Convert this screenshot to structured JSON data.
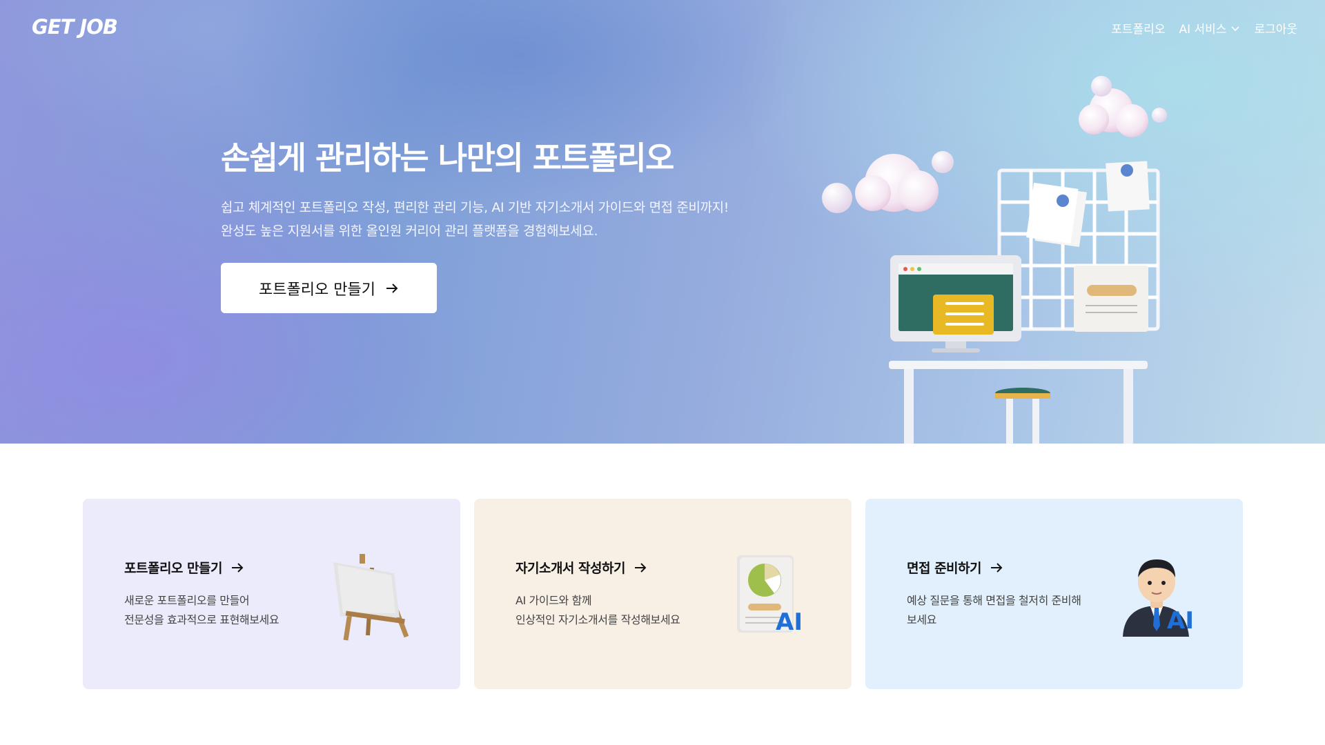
{
  "header": {
    "logo": "GET JOB",
    "nav": [
      {
        "label": "포트폴리오"
      },
      {
        "label": "AI 서비스",
        "icon": "chevron-down-icon"
      },
      {
        "label": "로그아웃"
      }
    ]
  },
  "hero": {
    "title": "손쉽게 관리하는 나만의 포트폴리오",
    "subtitle_lines": [
      "쉽고 체계적인 포트폴리오 작성, 편리한 관리 기능, AI 기반 자기소개서 가이드와 면접 준비까지!",
      "완성도 높은 지원서를 위한 올인원 커리어 관리 플랫폼을 경험해보세요."
    ],
    "cta_label": "포트폴리오 만들기",
    "cta_icon": "arrow-right-icon"
  },
  "cards": [
    {
      "title": "포트폴리오 만들기",
      "desc_lines": [
        "새로운 포트폴리오를 만들어",
        "전문성을 효과적으로 표현해보세요"
      ],
      "icon": "easel-icon",
      "bg": "#ecebfb"
    },
    {
      "title": "자기소개서 작성하기",
      "desc_lines": [
        "AI 가이드와 함께",
        "인상적인 자기소개서를 작성해보세요"
      ],
      "icon": "ai-document-icon",
      "badge": "AI",
      "bg": "#f8efe5"
    },
    {
      "title": "면접 준비하기",
      "desc_lines": [
        "예상 질문을 통해 면접을 철저히 준비해",
        "보세요"
      ],
      "icon": "ai-interviewer-icon",
      "badge": "AI",
      "bg": "#e1f0fc"
    }
  ],
  "colors": {
    "hero_gradient_start": "#8f97dc",
    "hero_gradient_end": "#bfdbea",
    "ai_badge": "#1f6fd6"
  }
}
